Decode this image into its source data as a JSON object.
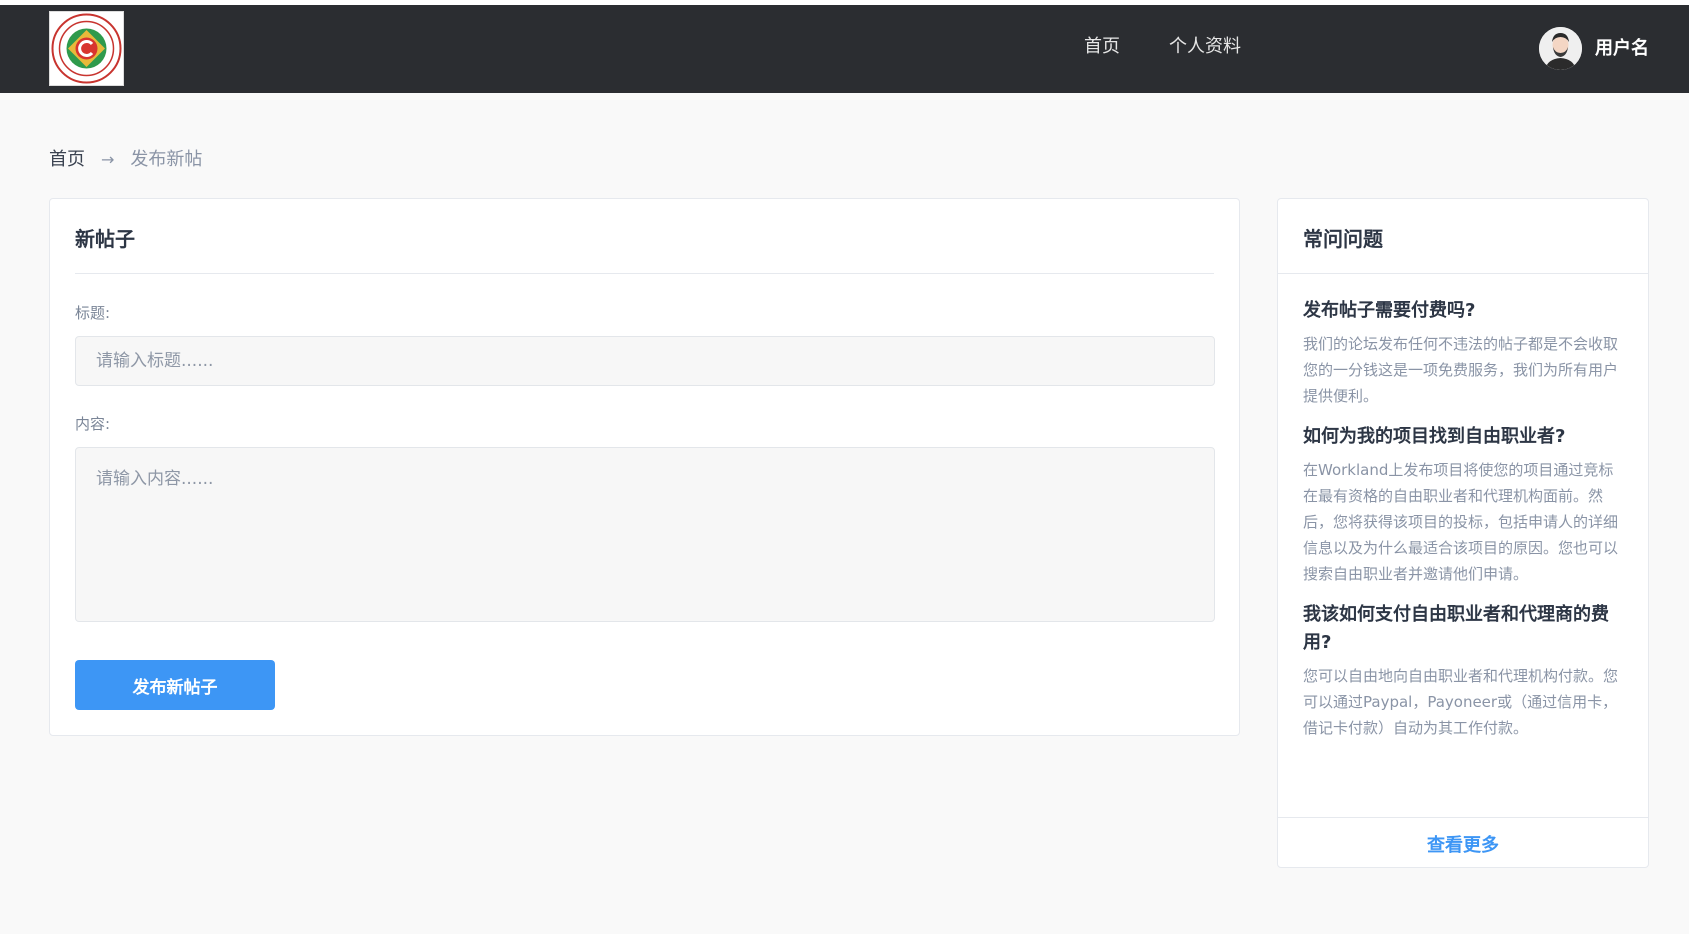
{
  "header": {
    "nav": [
      {
        "label": "首页"
      },
      {
        "label": "个人资料"
      }
    ],
    "username": "用户名",
    "logo_icon": "university-seal-logo",
    "avatar_icon": "user-avatar"
  },
  "breadcrumb": {
    "home": "首页",
    "separator": "→",
    "current": "发布新帖"
  },
  "form": {
    "title": "新帖子",
    "title_label": "标题:",
    "title_placeholder": "请输入标题......",
    "content_label": "内容:",
    "content_placeholder": "请输入内容......",
    "submit_label": "发布新帖子"
  },
  "faq": {
    "title": "常问问题",
    "items": [
      {
        "question": "发布帖子需要付费吗?",
        "answer": "我们的论坛发布任何不违法的帖子都是不会收取您的一分钱这是一项免费服务，我们为所有用户提供便利。"
      },
      {
        "question": "如何为我的项目找到自由职业者?",
        "answer": "在Workland上发布项目将使您的项目通过竞标在最有资格的自由职业者和代理机构面前。然后，您将获得该项目的投标，包括申请人的详细信息以及为什么最适合该项目的原因。您也可以搜索自由职业者并邀请他们申请。"
      },
      {
        "question": "我该如何支付自由职业者和代理商的费用?",
        "answer": "您可以自由地向自由职业者和代理机构付款。您可以通过Paypal，Payoneer或（通过信用卡，借记卡付款）自动为其工作付款。"
      }
    ],
    "more_label": "查看更多"
  },
  "colors": {
    "topbar": "#2b2d31",
    "accent": "#3d96f5",
    "page_bg": "#f9f9f9"
  }
}
